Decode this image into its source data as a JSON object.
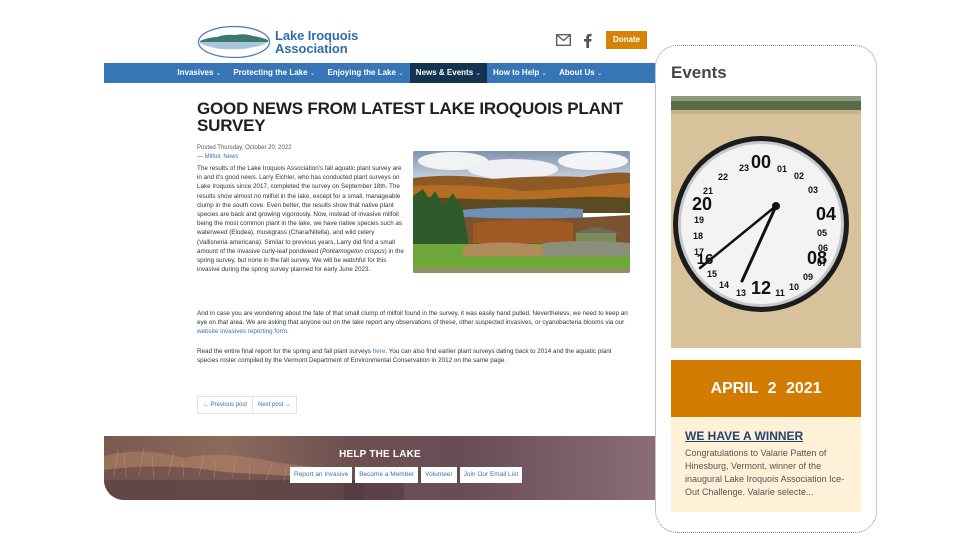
{
  "header": {
    "logo_line1": "Lake Iroquois",
    "logo_line2": "Association",
    "donate_label": "Donate",
    "icons": [
      "mail-icon",
      "facebook-icon"
    ]
  },
  "nav": {
    "items": [
      {
        "label": "Invasives",
        "active": false
      },
      {
        "label": "Protecting the Lake",
        "active": false
      },
      {
        "label": "Enjoying the Lake",
        "active": false
      },
      {
        "label": "News & Events",
        "active": true
      },
      {
        "label": "How to Help",
        "active": false
      },
      {
        "label": "About Us",
        "active": false
      }
    ],
    "caret": "⌄"
  },
  "article": {
    "title": "GOOD NEWS FROM LATEST LAKE IROQUOIS PLANT SURVEY",
    "posted": "Posted Thursday, October 20, 2022",
    "category_prefix": "— ",
    "categories": "Milfoil, News",
    "para1": "The results of the Lake Iroquois Association's fall aquatic plant survey are in and it's good news. Larry Eichler, who has conducted plant surveys on Lake Iroquois since 2017, completed the survey on September 18th. The results show almost no milfoil in the lake, except for a small, manageable clump in the south cove. Even better, the results show that native plant species are back and growing vigorously.  Now, instead of invasive milfoil being the most common plant in the lake, we have native species such as waterweed (Elodea), muskgrass (Chara/Nitella), and wild celery (Vallisneria americana).  Similar to previous years, Larry did find a small amount of the invasive curly-leaf pondweed (",
    "para1_italic": "Pontamogeton crispus",
    "para1_end": ") in the spring survey, but none in the fall survey.  We will be watchful for this invasive during the spring survey planned for early June 2023.",
    "para2_start": "And in case you are wondering about the fate of that small clump of milfoil found in the survey, it was easily hand pulled. Nevertheless, we need to keep an eye on that area. We are asking that anyone out on the lake report any observations of these, other suspected invasives, or cyanobacteria blooms  via our ",
    "para2_link": "website invasives reporting form",
    "para2_end": ".",
    "para3_start": "Read the entire final report for the spring and fall plant surveys ",
    "para3_link": "here",
    "para3_end": ".   You can also find earlier plant surveys dating back to 2014 and the aquatic plant species roster compiled by the Vermont Department of Environmental Conservation in 2012 on the same page.",
    "photo_alt": "Autumn view of Lake Iroquois with colorful foliage"
  },
  "pager": {
    "previous": "← Previous post",
    "next": "Next post →"
  },
  "footer": {
    "title": "HELP THE LAKE",
    "buttons": [
      "Report an Invasive",
      "Become a Member",
      "Volunteer",
      "Join Our Email List"
    ]
  },
  "events": {
    "title": "Events",
    "photo_alt": "24-hour clock mounted on plywood",
    "date": "APRIL  2  2021",
    "headline": "WE HAVE A WINNER",
    "description": "Congratulations to Valarie Patten of Hinesburg, Vermont, winner of the inaugural Lake Iroquois Association Ice-Out Challenge. Valarie selecte...",
    "colors": {
      "date_bg": "#d17c00",
      "card_bg": "#fff0d8",
      "headline": "#23466b"
    }
  },
  "colors": {
    "nav_bg": "#3875b7",
    "nav_active": "#14334f",
    "donate": "#d68406",
    "link": "#3a70b5",
    "logo_text": "#2f6ea8"
  }
}
